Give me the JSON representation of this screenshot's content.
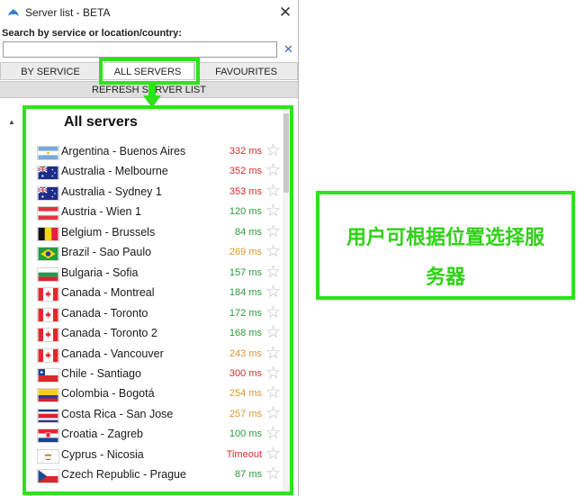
{
  "window": {
    "title": "Server list - BETA",
    "close_glyph": "✕"
  },
  "search": {
    "label": "Search by service or location/country:",
    "value": "",
    "placeholder": "",
    "clear_glyph": "✕"
  },
  "tabs": [
    {
      "label": "BY SERVICE"
    },
    {
      "label": "ALL SERVERS",
      "active": true
    },
    {
      "label": "FAVOURITES"
    }
  ],
  "refresh_label": "REFRESH SERVER LIST",
  "list": {
    "title": "All servers",
    "expander_glyph": "▲",
    "servers": [
      {
        "name": "Argentina - Buenos Aires",
        "latency": "332 ms",
        "status": "red",
        "flag": "argentina"
      },
      {
        "name": "Australia - Melbourne",
        "latency": "352 ms",
        "status": "red",
        "flag": "australia"
      },
      {
        "name": "Australia - Sydney 1",
        "latency": "353 ms",
        "status": "red",
        "flag": "australia"
      },
      {
        "name": "Austria - Wien 1",
        "latency": "120 ms",
        "status": "green",
        "flag": "austria"
      },
      {
        "name": "Belgium - Brussels",
        "latency": "84 ms",
        "status": "green",
        "flag": "belgium"
      },
      {
        "name": "Brazil - Sao Paulo",
        "latency": "269 ms",
        "status": "orange",
        "flag": "brazil"
      },
      {
        "name": "Bulgaria - Sofia",
        "latency": "157 ms",
        "status": "green",
        "flag": "bulgaria"
      },
      {
        "name": "Canada - Montreal",
        "latency": "184 ms",
        "status": "green",
        "flag": "canada"
      },
      {
        "name": "Canada - Toronto",
        "latency": "172 ms",
        "status": "green",
        "flag": "canada"
      },
      {
        "name": "Canada - Toronto 2",
        "latency": "168 ms",
        "status": "green",
        "flag": "canada"
      },
      {
        "name": "Canada - Vancouver",
        "latency": "243 ms",
        "status": "orange",
        "flag": "canada"
      },
      {
        "name": "Chile - Santiago",
        "latency": "300 ms",
        "status": "red",
        "flag": "chile"
      },
      {
        "name": "Colombia - Bogotá",
        "latency": "254 ms",
        "status": "orange",
        "flag": "colombia"
      },
      {
        "name": "Costa Rica - San Jose",
        "latency": "257 ms",
        "status": "orange",
        "flag": "costa-rica"
      },
      {
        "name": "Croatia - Zagreb",
        "latency": "100 ms",
        "status": "green",
        "flag": "croatia"
      },
      {
        "name": "Cyprus - Nicosia",
        "latency": "Timeout",
        "status": "red",
        "flag": "cyprus"
      },
      {
        "name": "Czech Republic - Prague",
        "latency": "87 ms",
        "status": "green",
        "flag": "czech"
      }
    ]
  },
  "status_colors": {
    "red": "#d92b2b",
    "orange": "#e0962a",
    "green": "#2a9b3c"
  },
  "highlight_color": "#2ee31b",
  "callout": {
    "line1": "用户可根据位置选择服",
    "line2": "务器"
  }
}
